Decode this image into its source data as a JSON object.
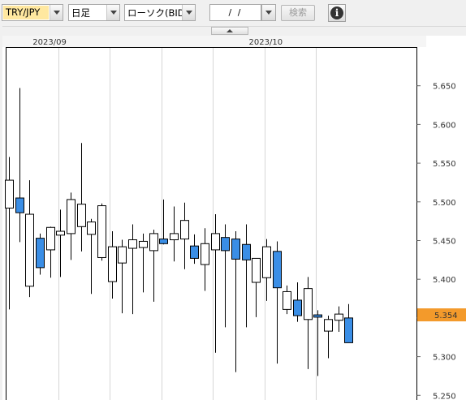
{
  "toolbar": {
    "pair_value": "TRY/JPY",
    "period_value": "日足",
    "chart_type_value": "ローソク(BID)",
    "date_value": "/ /",
    "search_label": "検索",
    "info_label": "i"
  },
  "colors": {
    "bear": "#3a8ee6",
    "bull": "#ffffff",
    "current_price_bg": "#f39a2b",
    "grid": "#d6d6d6"
  },
  "chart_data": {
    "type": "candlestick",
    "month_labels": [
      {
        "label": "2023/09",
        "index": 3
      },
      {
        "label": "2023/10",
        "index": 24
      }
    ],
    "y_ticks": [
      "5.650",
      "5.600",
      "5.550",
      "5.500",
      "5.450",
      "5.400",
      "5.350",
      "5.300",
      "5.250"
    ],
    "y_tick_values": [
      5.65,
      5.6,
      5.55,
      5.5,
      5.45,
      5.4,
      5.35,
      5.3,
      5.25
    ],
    "ylim": [
      5.244,
      5.7
    ],
    "current_price": "5.354",
    "current_price_value": 5.354,
    "vertical_grid_after_index": [
      4,
      9,
      14,
      19,
      24,
      29
    ],
    "candles": [
      {
        "o": 5.492,
        "h": 5.558,
        "l": 5.361,
        "c": 5.528
      },
      {
        "o": 5.505,
        "h": 5.647,
        "l": 5.448,
        "c": 5.486
      },
      {
        "o": 5.391,
        "h": 5.528,
        "l": 5.377,
        "c": 5.484
      },
      {
        "o": 5.453,
        "h": 5.459,
        "l": 5.406,
        "c": 5.415
      },
      {
        "o": 5.438,
        "h": 5.468,
        "l": 5.402,
        "c": 5.467
      },
      {
        "o": 5.457,
        "h": 5.49,
        "l": 5.403,
        "c": 5.462
      },
      {
        "o": 5.459,
        "h": 5.512,
        "l": 5.425,
        "c": 5.503
      },
      {
        "o": 5.468,
        "h": 5.576,
        "l": 5.436,
        "c": 5.497
      },
      {
        "o": 5.458,
        "h": 5.478,
        "l": 5.381,
        "c": 5.474
      },
      {
        "o": 5.428,
        "h": 5.498,
        "l": 5.424,
        "c": 5.495
      },
      {
        "o": 5.397,
        "h": 5.462,
        "l": 5.375,
        "c": 5.442
      },
      {
        "o": 5.421,
        "h": 5.451,
        "l": 5.356,
        "c": 5.442
      },
      {
        "o": 5.44,
        "h": 5.471,
        "l": 5.355,
        "c": 5.451
      },
      {
        "o": 5.441,
        "h": 5.459,
        "l": 5.383,
        "c": 5.449
      },
      {
        "o": 5.437,
        "h": 5.464,
        "l": 5.371,
        "c": 5.459
      },
      {
        "o": 5.452,
        "h": 5.503,
        "l": 5.445,
        "c": 5.446
      },
      {
        "o": 5.451,
        "h": 5.494,
        "l": 5.423,
        "c": 5.459
      },
      {
        "o": 5.452,
        "h": 5.499,
        "l": 5.413,
        "c": 5.476
      },
      {
        "o": 5.443,
        "h": 5.458,
        "l": 5.42,
        "c": 5.427
      },
      {
        "o": 5.419,
        "h": 5.466,
        "l": 5.385,
        "c": 5.446
      },
      {
        "o": 5.438,
        "h": 5.484,
        "l": 5.305,
        "c": 5.459
      },
      {
        "o": 5.454,
        "h": 5.471,
        "l": 5.338,
        "c": 5.437
      },
      {
        "o": 5.452,
        "h": 5.462,
        "l": 5.28,
        "c": 5.426
      },
      {
        "o": 5.445,
        "h": 5.471,
        "l": 5.338,
        "c": 5.425
      },
      {
        "o": 5.396,
        "h": 5.422,
        "l": 5.351,
        "c": 5.427
      },
      {
        "o": 5.402,
        "h": 5.452,
        "l": 5.372,
        "c": 5.442
      },
      {
        "o": 5.436,
        "h": 5.449,
        "l": 5.291,
        "c": 5.389
      },
      {
        "o": 5.361,
        "h": 5.392,
        "l": 5.355,
        "c": 5.384
      },
      {
        "o": 5.373,
        "h": 5.396,
        "l": 5.345,
        "c": 5.353
      },
      {
        "o": 5.348,
        "h": 5.403,
        "l": 5.284,
        "c": 5.388
      },
      {
        "o": 5.354,
        "h": 5.36,
        "l": 5.275,
        "c": 5.351
      },
      {
        "o": 5.333,
        "h": 5.353,
        "l": 5.298,
        "c": 5.348
      },
      {
        "o": 5.347,
        "h": 5.365,
        "l": 5.332,
        "c": 5.355
      },
      {
        "o": 5.35,
        "h": 5.368,
        "l": 5.318,
        "c": 5.318
      }
    ]
  }
}
